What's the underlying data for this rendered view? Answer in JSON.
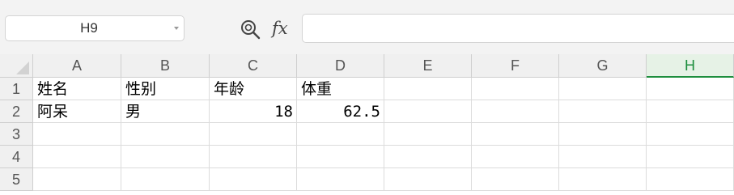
{
  "name_box": {
    "value": "H9"
  },
  "formula_bar": {
    "fx_label": "fx",
    "value": ""
  },
  "columns": [
    "A",
    "B",
    "C",
    "D",
    "E",
    "F",
    "G",
    "H"
  ],
  "active_column": "H",
  "rows": [
    "1",
    "2",
    "3",
    "4",
    "5"
  ],
  "cells": {
    "A1": "姓名",
    "B1": "性别",
    "C1": "年龄",
    "D1": "体重",
    "A2": "阿呆",
    "B2": "男",
    "C2": "18",
    "D2": "62.5"
  },
  "colors": {
    "active_header": "#1e8e3e"
  }
}
